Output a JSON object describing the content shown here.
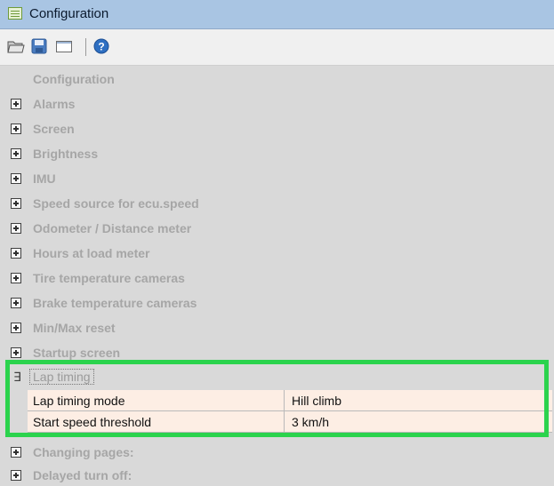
{
  "window": {
    "title": "Configuration"
  },
  "toolbar": {
    "icons": [
      "open-folder-icon",
      "save-icon",
      "window-icon",
      "help-icon"
    ]
  },
  "tree": {
    "root_label": "Configuration",
    "groups": [
      "Alarms",
      "Screen",
      "Brightness",
      "IMU",
      "Speed source for ecu.speed",
      "Odometer / Distance meter",
      "Hours at load meter",
      "Tire temperature cameras",
      "Brake temperature cameras",
      "Min/Max reset",
      "Startup screen"
    ],
    "expanded_group": {
      "label": "Lap timing",
      "properties": [
        {
          "name": "Lap timing mode",
          "value": "Hill climb"
        },
        {
          "name": "Start speed threshold",
          "value": "3 km/h"
        }
      ]
    },
    "groups_after": [
      "Changing pages:",
      "Delayed turn off:"
    ]
  },
  "colors": {
    "highlight": "#2bd34d",
    "property_bg": "#fdeee4",
    "titlebar": "#a9c5e3"
  }
}
